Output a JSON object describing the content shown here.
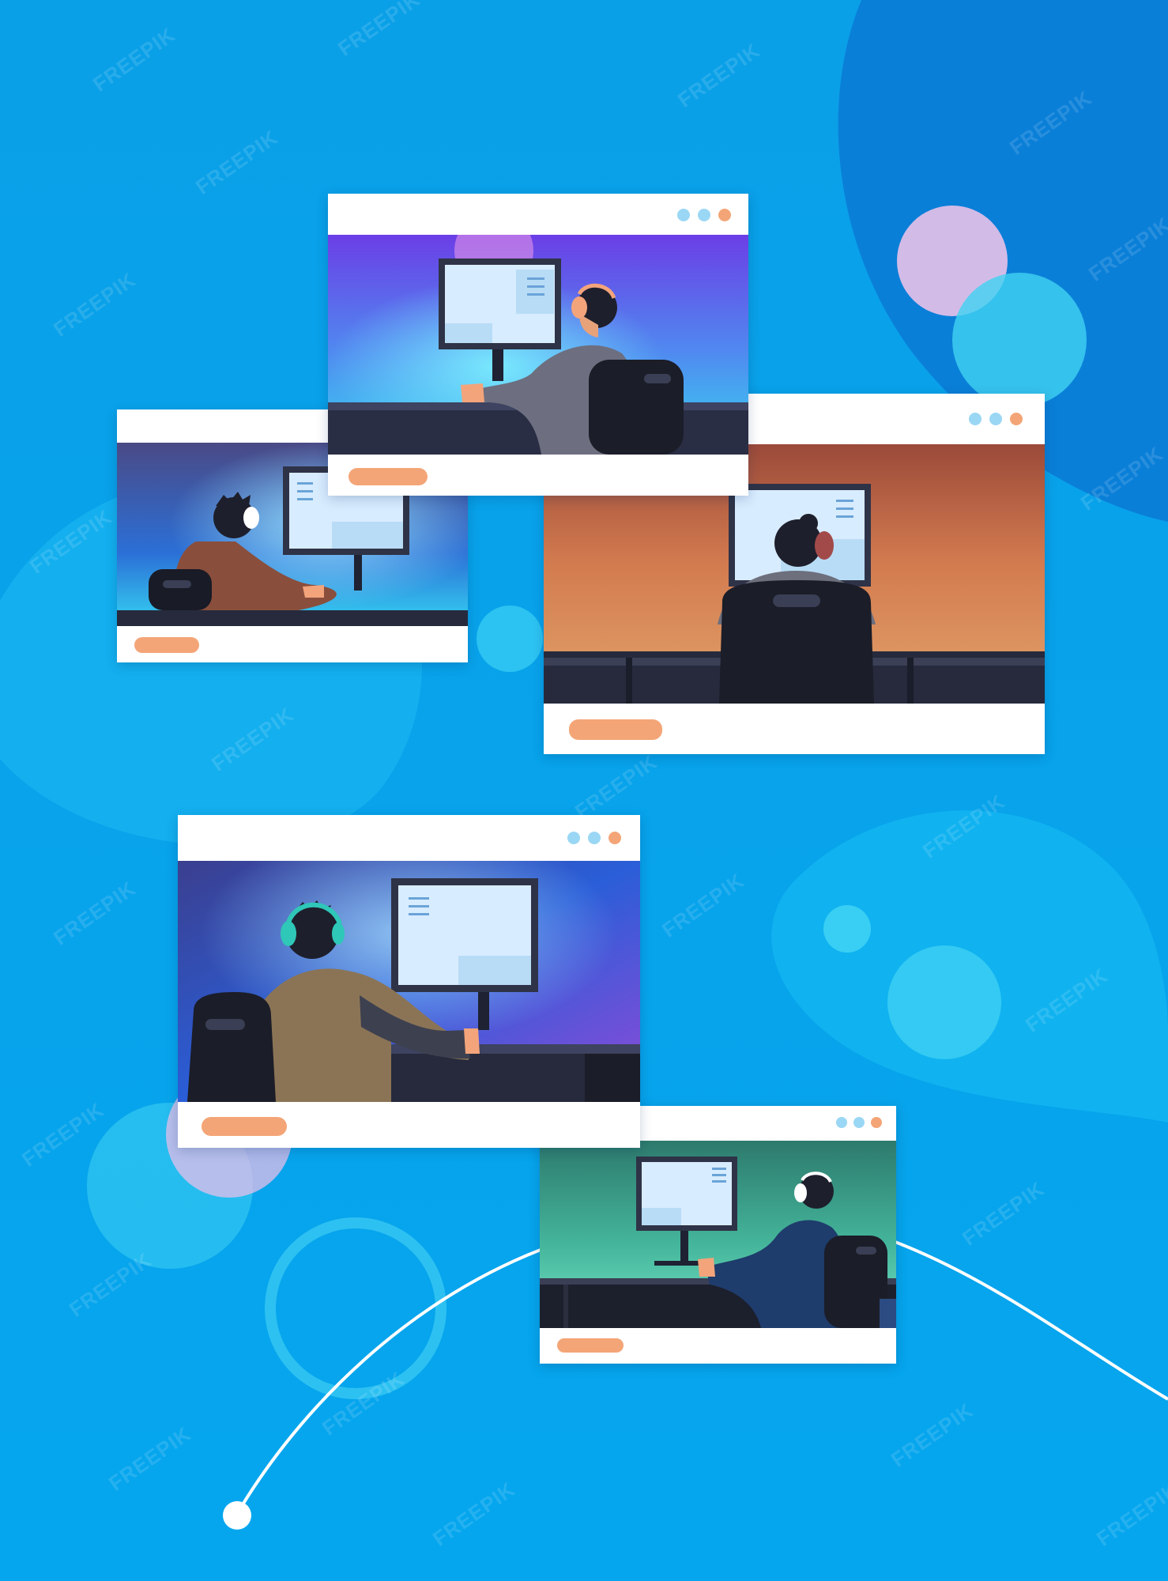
{
  "background": {
    "base_color": "#0aa6ea",
    "accent_blob_color": "#0a7fd8",
    "light_blob_color": "#33c6f4"
  },
  "watermark": {
    "text": "FREEPIK"
  },
  "windows": [
    {
      "id": "window-top",
      "scene": "purple-monitor",
      "dot_colors": [
        "#9ad7f5",
        "#9ad7f5",
        "#f4a577"
      ]
    },
    {
      "id": "window-left",
      "scene": "blue-back-view",
      "dot_colors": []
    },
    {
      "id": "window-right",
      "scene": "orange-back-view",
      "dot_colors": [
        "#9ad7f5",
        "#9ad7f5",
        "#f4a577"
      ]
    },
    {
      "id": "window-lower-left",
      "scene": "dark-blue-headset",
      "dot_colors": [
        "#9ad7f5",
        "#9ad7f5",
        "#f4a577"
      ]
    },
    {
      "id": "window-lower-right",
      "scene": "teal-side-view",
      "dot_colors": [
        "#9ad7f5",
        "#9ad7f5",
        "#f4a577"
      ]
    }
  ],
  "colors": {
    "pill": "#f4a577",
    "dot": "#9ad7f5",
    "window_bg": "#ffffff"
  }
}
